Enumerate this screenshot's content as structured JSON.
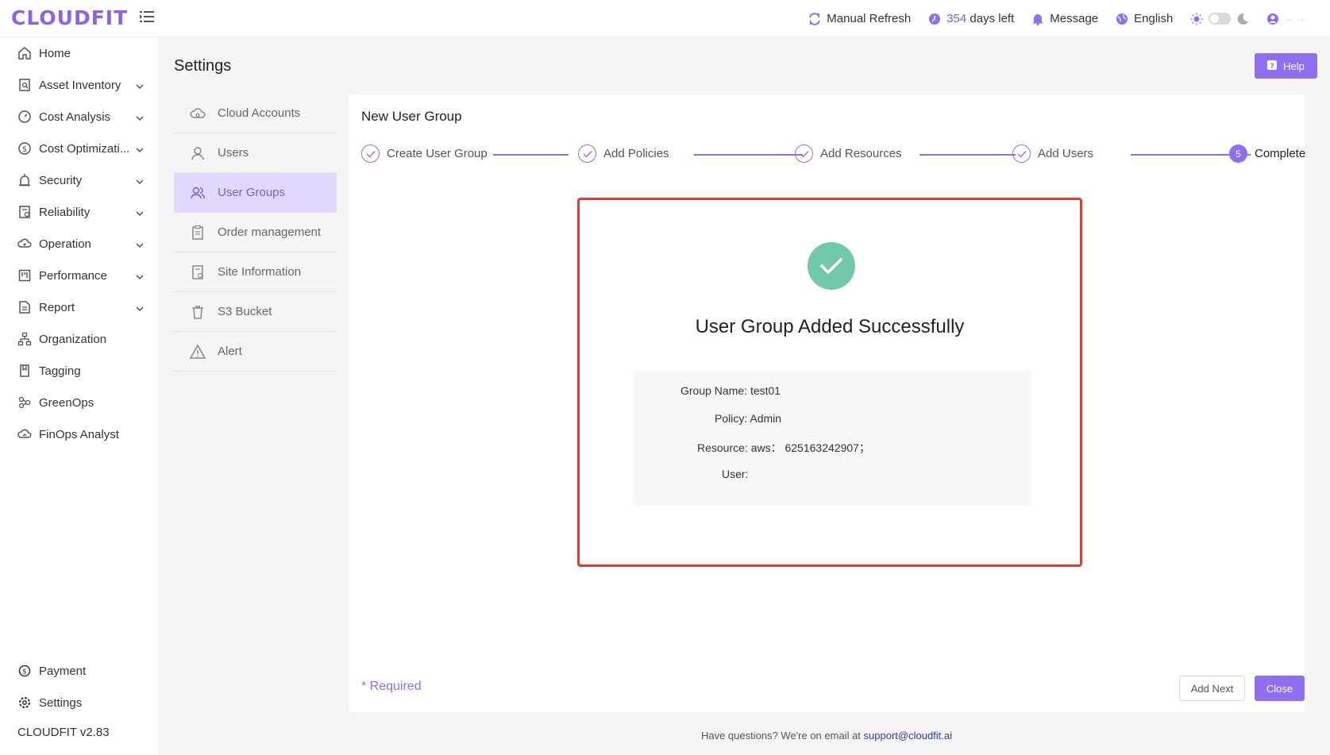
{
  "app": {
    "logo": "CLOUDFIT",
    "version": "CLOUDFIT v2.83"
  },
  "topbar": {
    "refresh": "Manual Refresh",
    "days_count": "354",
    "days_suffix": "days left",
    "message": "Message",
    "language": "English",
    "user_name": "·-. ·-·"
  },
  "sidebar": {
    "items": [
      {
        "label": "Home",
        "icon": "home-icon"
      },
      {
        "label": "Asset Inventory",
        "icon": "asset-icon"
      },
      {
        "label": "Cost Analysis",
        "icon": "gauge-icon"
      },
      {
        "label": "Cost Optimizati...",
        "icon": "dollar-icon"
      },
      {
        "label": "Security",
        "icon": "alarm-icon"
      },
      {
        "label": "Reliability",
        "icon": "reliability-icon"
      },
      {
        "label": "Operation",
        "icon": "cloud-gear-icon"
      },
      {
        "label": "Performance",
        "icon": "performance-icon"
      },
      {
        "label": "Report",
        "icon": "report-icon"
      },
      {
        "label": "Organization",
        "icon": "org-icon"
      },
      {
        "label": "Tagging",
        "icon": "tag-icon"
      },
      {
        "label": "GreenOps",
        "icon": "leaf-icon"
      },
      {
        "label": "FinOps Analyst",
        "icon": "finops-icon"
      }
    ],
    "payment": "Payment",
    "settings": "Settings"
  },
  "main": {
    "title": "Settings",
    "help": "Help",
    "submenu": [
      {
        "label": "Cloud Accounts"
      },
      {
        "label": "Users"
      },
      {
        "label": "User Groups"
      },
      {
        "label": "Order management"
      },
      {
        "label": "Site Information"
      },
      {
        "label": "S3 Bucket"
      },
      {
        "label": "Alert"
      }
    ]
  },
  "wizard": {
    "title": "New User Group",
    "steps": [
      {
        "label": "Create User Group"
      },
      {
        "label": "Add Policies"
      },
      {
        "label": "Add Resources"
      },
      {
        "label": "Add Users"
      },
      {
        "label": "Complete",
        "number": "5"
      }
    ],
    "success_title": "User Group Added Successfully",
    "details": {
      "group_name_label": "Group Name:",
      "group_name": "test01",
      "policy_label": "Policy:",
      "policy": "Admin",
      "resource_label": "Resource:",
      "resource": "aws： 625163242907；",
      "user_label": "User:",
      "user": ""
    },
    "required": "* Required",
    "add_next": "Add Next",
    "close": "Close"
  },
  "footer": {
    "text": "Have questions? We're on email at",
    "email": "support@cloudfit.ai"
  },
  "colors": {
    "accent": "#8f6ff0",
    "success": "#72c8ad",
    "highlight": "#e53a2f"
  }
}
